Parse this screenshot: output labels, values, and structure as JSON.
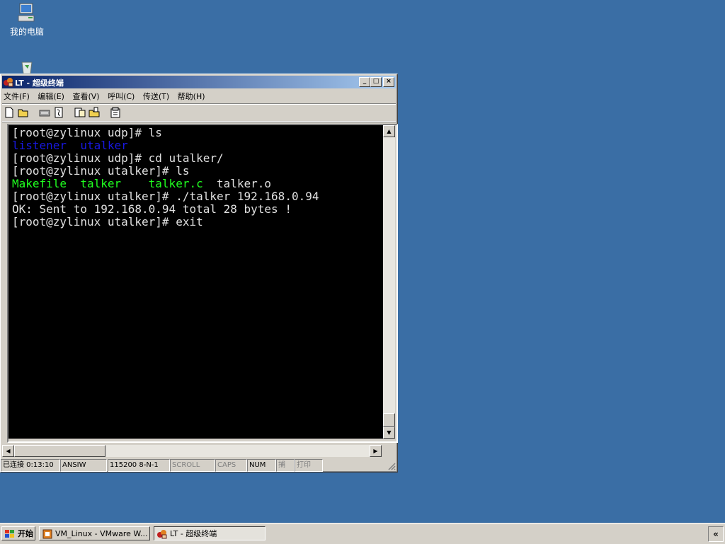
{
  "desktop": {
    "icons": [
      {
        "label": "我的电脑"
      },
      {
        "label": ""
      }
    ]
  },
  "window": {
    "title": "LT - 超级终端",
    "controls": {
      "min": "_",
      "max": "□",
      "close": "×"
    },
    "menu": [
      {
        "label": "文件(F)"
      },
      {
        "label": "编辑(E)"
      },
      {
        "label": "查看(V)"
      },
      {
        "label": "呼叫(C)"
      },
      {
        "label": "传送(T)"
      },
      {
        "label": "帮助(H)"
      }
    ],
    "toolbar_icons": [
      "new-icon",
      "open-icon",
      "disconnect-icon",
      "dial-icon",
      "send-icon",
      "receive-icon",
      "properties-icon"
    ]
  },
  "terminal": {
    "lines": [
      [
        {
          "t": "[root@zylinux udp]# ls",
          "c": "white"
        }
      ],
      [
        {
          "t": "listener  utalker",
          "c": "blue"
        }
      ],
      [
        {
          "t": "[root@zylinux udp]# cd utalker/",
          "c": "white"
        }
      ],
      [
        {
          "t": "[root@zylinux utalker]# ls",
          "c": "white"
        }
      ],
      [
        {
          "t": "Makefile  talker    talker.c",
          "c": "green"
        },
        {
          "t": "  talker.o",
          "c": "white"
        }
      ],
      [
        {
          "t": "[root@zylinux utalker]# ./talker 192.168.0.94",
          "c": "white"
        }
      ],
      [
        {
          "t": "OK: Sent to 192.168.0.94 total 28 bytes !",
          "c": "white"
        }
      ],
      [
        {
          "t": "[root@zylinux utalker]# exit",
          "c": "white"
        }
      ]
    ]
  },
  "status": {
    "connection": "已连接 0:13:10",
    "emulation": "ANSIW",
    "settings": "115200 8-N-1",
    "scroll": "SCROLL",
    "caps": "CAPS",
    "num": "NUM",
    "capture": "捕",
    "print": "打印"
  },
  "taskbar": {
    "start": "开始",
    "tasks": [
      {
        "label": "VM_Linux - VMware W..."
      },
      {
        "label": "LT - 超级终端"
      }
    ],
    "tray_toggle": "«"
  }
}
